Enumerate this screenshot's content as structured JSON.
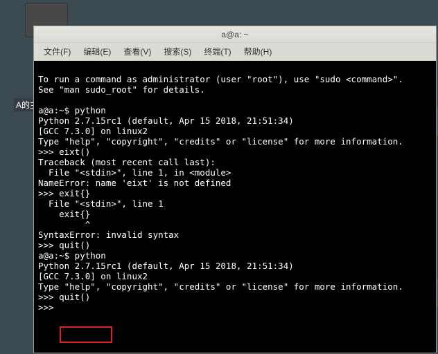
{
  "desktop": {
    "icon_label": "A的主文件夹"
  },
  "window": {
    "title": "a@a: ~"
  },
  "menu": {
    "file": "文件(F)",
    "edit": "编辑(E)",
    "view": "查看(V)",
    "search": "搜索(S)",
    "terminal": "终端(T)",
    "help": "帮助(H)"
  },
  "terminal": {
    "lines": [
      "To run a command as administrator (user \"root\"), use \"sudo <command>\".",
      "See \"man sudo_root\" for details.",
      "",
      "a@a:~$ python",
      "Python 2.7.15rc1 (default, Apr 15 2018, 21:51:34)",
      "[GCC 7.3.0] on linux2",
      "Type \"help\", \"copyright\", \"credits\" or \"license\" for more information.",
      ">>> eixt()",
      "Traceback (most recent call last):",
      "  File \"<stdin>\", line 1, in <module>",
      "NameError: name 'eixt' is not defined",
      ">>> exit{}",
      "  File \"<stdin>\", line 1",
      "    exit{}",
      "         ^",
      "SyntaxError: invalid syntax",
      ">>> quit()",
      "a@a:~$ python",
      "Python 2.7.15rc1 (default, Apr 15 2018, 21:51:34)",
      "[GCC 7.3.0] on linux2",
      "Type \"help\", \"copyright\", \"credits\" or \"license\" for more information.",
      ">>> quit()",
      ">>>"
    ]
  },
  "highlight": {
    "target": "quit()"
  }
}
